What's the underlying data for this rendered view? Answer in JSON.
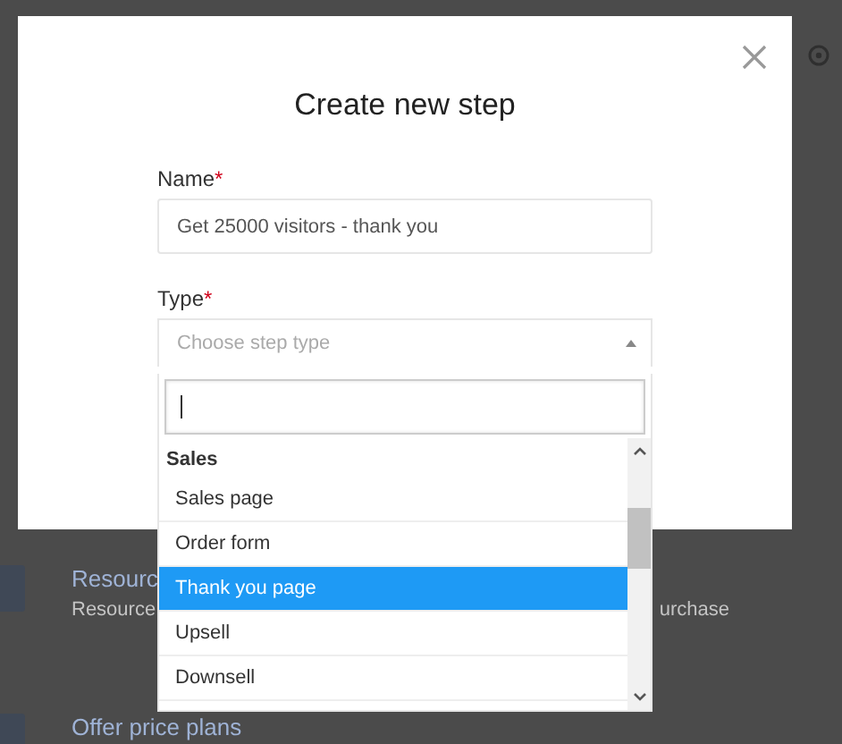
{
  "background": {
    "items": [
      {
        "title": "Resourc",
        "subtitle": "Resource",
        "subtitle_tail": "urchase"
      },
      {
        "title": "Offer price plans"
      }
    ]
  },
  "modal": {
    "title": "Create new step",
    "fields": [
      {
        "label": "Name",
        "required_mark": "*",
        "value": "Get 25000 visitors - thank you"
      },
      {
        "label": "Type",
        "required_mark": "*",
        "placeholder": "Choose step type"
      }
    ]
  },
  "dropdown": {
    "groups": [
      {
        "label": "Sales",
        "options": [
          {
            "label": "Sales page",
            "selected": false
          },
          {
            "label": "Order form",
            "selected": false
          },
          {
            "label": "Thank you page",
            "selected": true
          },
          {
            "label": "Upsell",
            "selected": false
          },
          {
            "label": "Downsell",
            "selected": false
          }
        ]
      }
    ]
  }
}
